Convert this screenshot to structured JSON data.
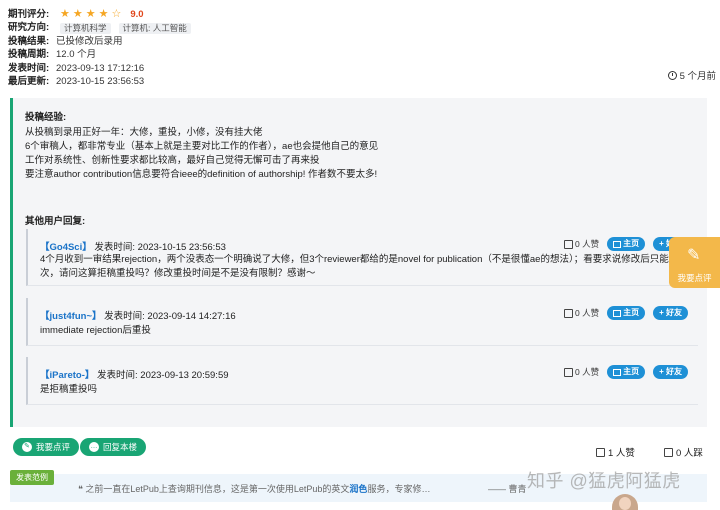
{
  "meta": {
    "rating_label": "期刊评分:",
    "stars": "★★★★☆",
    "score": "9.0",
    "direction_label": "研究方向:",
    "direction_tags": [
      "计算机科学",
      "计算机: 人工智能"
    ],
    "result_label": "投稿结果:",
    "result_value": "已投修改后录用",
    "period_label": "投稿周期:",
    "period_value": "12.0 个月",
    "publish_label": "发表时间:",
    "publish_value": "2023-09-13 17:12:16",
    "update_label": "最后更新:",
    "update_value": "2023-10-15 23:56:53",
    "ago": "5 个月前"
  },
  "experience": {
    "title": "投稿经验:",
    "lines": [
      "从投稿到录用正好一年：大修，重投，小修，没有挂大佬",
      "6个审稿人，都非常专业（基本上就是主要对比工作的作者），ae也会提他自己的意见",
      "工作对系统性、创新性要求都比较高，最好自己觉得无懈可击了再来投",
      "要注意author contribution信息要符合ieee的definition of authorship! 作者数不要太多!"
    ]
  },
  "others": {
    "title": "其他用户回复:",
    "replies": [
      {
        "name": "【Go4Sci】",
        "time_label": "发表时间: 2023-10-15 23:56:53",
        "body": "4个月收到一审结果rejection，两个没表态一个明确说了大修，但3个reviewer都给的是novel for publication（不是很懂ae的想法）；看要求说修改后只能投一次，请问这算拒稿重投吗？修改重投时间是不是没有限制？感谢～",
        "likes": "0 人赞",
        "home": "主页",
        "friend": "+ 好友"
      },
      {
        "name": "【just4fun~】",
        "time_label": "发表时间: 2023-09-14 14:27:16",
        "body": "immediate rejection后重投",
        "likes": "0 人赞",
        "home": "主页",
        "friend": "+ 好友"
      },
      {
        "name": "【iPareto-】",
        "time_label": "发表时间: 2023-09-13 20:59:59",
        "body": "是拒稿重投吗",
        "likes": "0 人赞",
        "home": "主页",
        "friend": "+ 好友"
      }
    ]
  },
  "float_button": "我要点评",
  "actions": {
    "review": "我要点评",
    "reply": "回复本楼",
    "likes": "1 人赞",
    "dislikes": "0 人踩"
  },
  "promo": {
    "tag": "发表范例",
    "text_before": "之前一直在LetPub上查询期刊信息，这是第一次使用LetPub的英文",
    "highlight": "润色",
    "text_after": "服务，专家修…",
    "author": "—— 曹青",
    "watermark": "知乎 @猛虎阿猛虎"
  }
}
